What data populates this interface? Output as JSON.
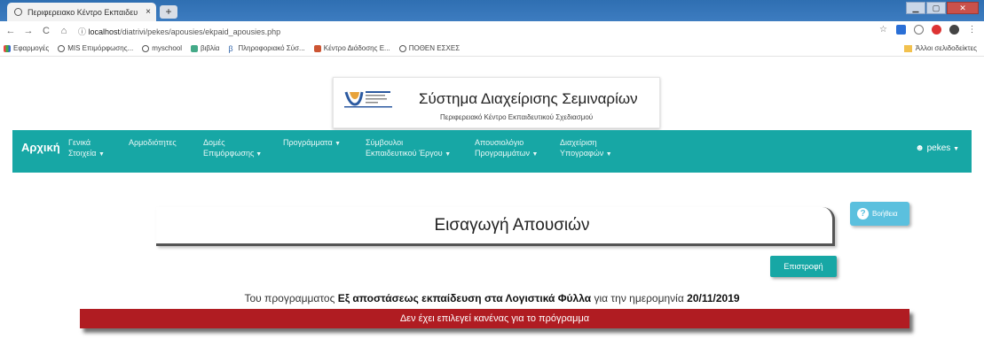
{
  "browser": {
    "tab_title": "Περιφερειακο Κέντρο Εκπαιδευ",
    "tab_close": "×",
    "new_tab": "+",
    "url_host": "localhost",
    "url_path": "/diatrivi/pekes/apousies/ekpaid_apousies.php",
    "url_info": "ⓘ",
    "bookmarks": [
      {
        "label": "Εφαρμογές",
        "icon": "apps-icon",
        "color": "#d44"
      },
      {
        "label": "MIS Επιμόρφωσης...",
        "icon": "globe-icon",
        "color": "#555"
      },
      {
        "label": "myschool",
        "icon": "globe-icon",
        "color": "#555"
      },
      {
        "label": "βιβλία",
        "icon": "book-icon",
        "color": "#4a8"
      },
      {
        "label": "Πληροφοριακό Σύσ...",
        "icon": "beta-icon",
        "color": "#36a"
      },
      {
        "label": "Κέντρο Διάδοσης Ε...",
        "icon": "flag-icon",
        "color": "#c53"
      },
      {
        "label": "ΠΟΘΕΝ ΕΣΧΕΣ",
        "icon": "globe-icon",
        "color": "#555"
      }
    ],
    "other_bookmarks": "Άλλοι σελιδοδείκτες"
  },
  "header": {
    "system_title": "Σύστημα Διαχείρισης Σεμιναρίων",
    "system_subtitle": "Περιφερειακό Κέντρο Εκπαιδευτικού Σχεδιασμού"
  },
  "nav": {
    "brand": "Αρχική",
    "items": [
      {
        "line1": "Γενικά",
        "line2": "Στοιχεία"
      },
      {
        "line1": "Αρμοδιότητες",
        "line2": ""
      },
      {
        "line1": "Δομές",
        "line2": "Επιμόρφωσης"
      },
      {
        "line1": "Προγράμματα",
        "line2": ""
      },
      {
        "line1": "Σύμβουλοι",
        "line2": "Εκπαιδευτικού Έργου"
      },
      {
        "line1": "Απουσιολόγιο",
        "line2": "Προγραμμάτων"
      },
      {
        "line1": "Διαχείριση",
        "line2": "Υπογραφών"
      }
    ],
    "user": "pekes"
  },
  "page": {
    "title": "Εισαγωγή Απουσιών",
    "help_label": "Βοήθεια",
    "back_label": "Επιστροφή",
    "info_prefix": "Του προγραμματος",
    "program_name": "Εξ αποστάσεως εκπαίδευση στα Λογιστικά Φύλλα",
    "info_middle": "για την ημερομηνία",
    "date": "20/11/2019",
    "alert": "Δεν έχει επιλεγεί κανένας για το πρόγραμμα"
  },
  "colors": {
    "navbar": "#17a7a5",
    "alert": "#b01c22",
    "help": "#5bc0de"
  }
}
